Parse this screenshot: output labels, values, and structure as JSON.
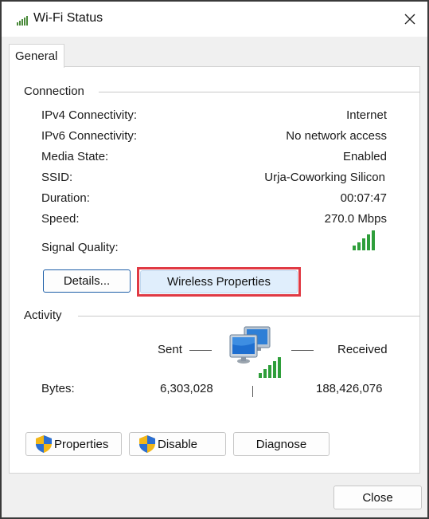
{
  "window": {
    "title": "Wi-Fi Status",
    "close_glyph": "✕"
  },
  "tabs": [
    {
      "label": "General",
      "selected": true
    }
  ],
  "connection": {
    "heading": "Connection",
    "rows": [
      {
        "label": "IPv4 Connectivity:",
        "value": "Internet"
      },
      {
        "label": "IPv6 Connectivity:",
        "value": "No network access"
      },
      {
        "label": "Media State:",
        "value": "Enabled"
      },
      {
        "label": "SSID:",
        "value": "Urja-Coworking Silicon"
      },
      {
        "label": "Duration:",
        "value": "00:07:47"
      },
      {
        "label": "Speed:",
        "value": "270.0 Mbps"
      }
    ],
    "signal_label": "Signal Quality:",
    "signal_bars": 5,
    "signal_max_bars": 5,
    "details_button": "Details...",
    "wireless_button": "Wireless Properties"
  },
  "activity": {
    "heading": "Activity",
    "sent_label": "Sent",
    "received_label": "Received",
    "bytes_label": "Bytes:",
    "bytes_sent": "6,303,028",
    "bytes_received": "188,426,076"
  },
  "actions": {
    "properties": "Properties",
    "disable": "Disable",
    "diagnose": "Diagnose"
  },
  "footer": {
    "close": "Close"
  },
  "colors": {
    "signal_green": "#2e9e3a",
    "highlight_red": "#e03a44",
    "focus_blue": "#1e5fa8"
  },
  "icons": [
    "wifi-signal-icon",
    "close-icon",
    "network-computers-icon",
    "signal-bars-icon",
    "uac-shield-icon"
  ]
}
